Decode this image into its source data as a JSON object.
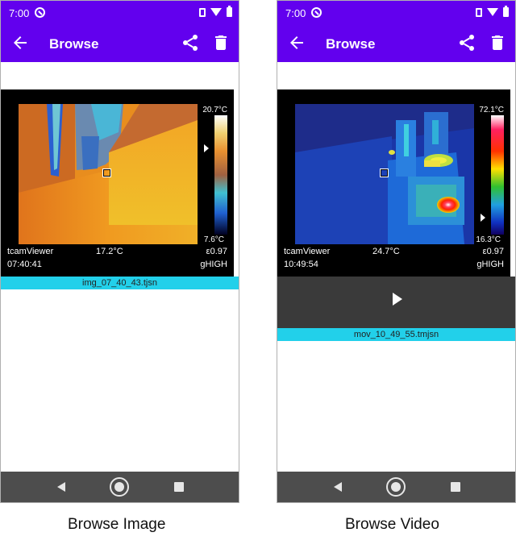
{
  "colors": {
    "accent": "#6200ee",
    "filename_bar": "#22d0ea",
    "navbar": "#4d4d4d",
    "video_bar": "#3a3a3a"
  },
  "left": {
    "status": {
      "time": "7:00"
    },
    "appbar": {
      "title": "Browse",
      "back_icon": "arrow-left-icon",
      "share_icon": "share-icon",
      "delete_icon": "trash-icon"
    },
    "thermal": {
      "max_temp": "20.7°C",
      "min_temp": "7.6°C",
      "app_name": "tcamViewer",
      "spot_temp": "17.2°C",
      "emissivity": "ε0.97",
      "timestamp": "07:40:41",
      "gain": "gHIGH",
      "palette": "iron",
      "colorbar_marker_level": 0.73,
      "spot_position_note": "spot meter box"
    },
    "filename": "img_07_40_43.tjsn",
    "caption": "Browse Image"
  },
  "right": {
    "status": {
      "time": "7:00"
    },
    "appbar": {
      "title": "Browse",
      "back_icon": "arrow-left-icon",
      "share_icon": "share-icon",
      "delete_icon": "trash-icon"
    },
    "thermal": {
      "max_temp": "72.1°C",
      "min_temp": "16.3°C",
      "app_name": "tcamViewer",
      "spot_temp": "24.7°C",
      "emissivity": "ε0.97",
      "timestamp": "10:49:54",
      "gain": "gHIGH",
      "palette": "rainbow",
      "colorbar_marker_level": 0.15
    },
    "play_icon": "play-icon",
    "filename": "mov_10_49_55.tmjsn",
    "caption": "Browse Video"
  }
}
